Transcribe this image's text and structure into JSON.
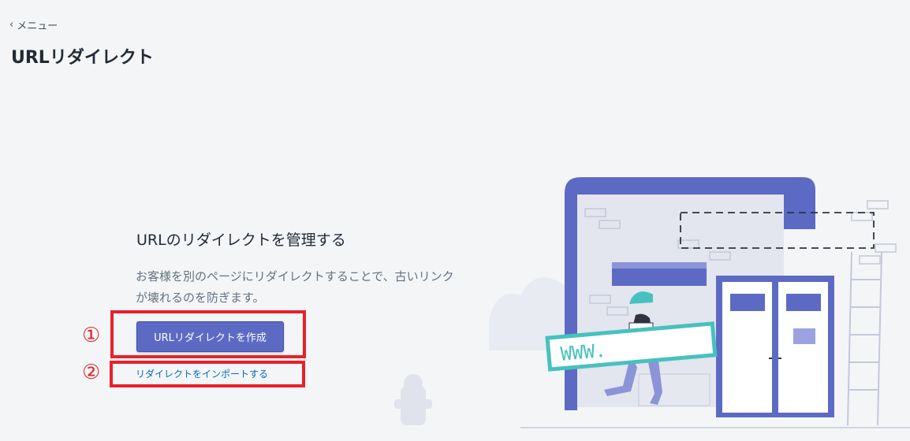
{
  "nav": {
    "back_label": "メニュー"
  },
  "page": {
    "title": "URLリダイレクト"
  },
  "empty_state": {
    "heading": "URLのリダイレクトを管理する",
    "description": "お客様を別のページにリダイレクトすることで、古いリンクが壊れるのを防ぎます。",
    "primary_action": "URLリダイレクトを作成",
    "secondary_action": "リダイレクトをインポートする"
  },
  "annotations": {
    "marker_1": "①",
    "marker_2": "②"
  },
  "illustration": {
    "sign_text": "WWW."
  },
  "colors": {
    "primary": "#5c6ac4",
    "link": "#006fbb",
    "annotation": "#e8212b",
    "teal": "#47c1bf"
  }
}
